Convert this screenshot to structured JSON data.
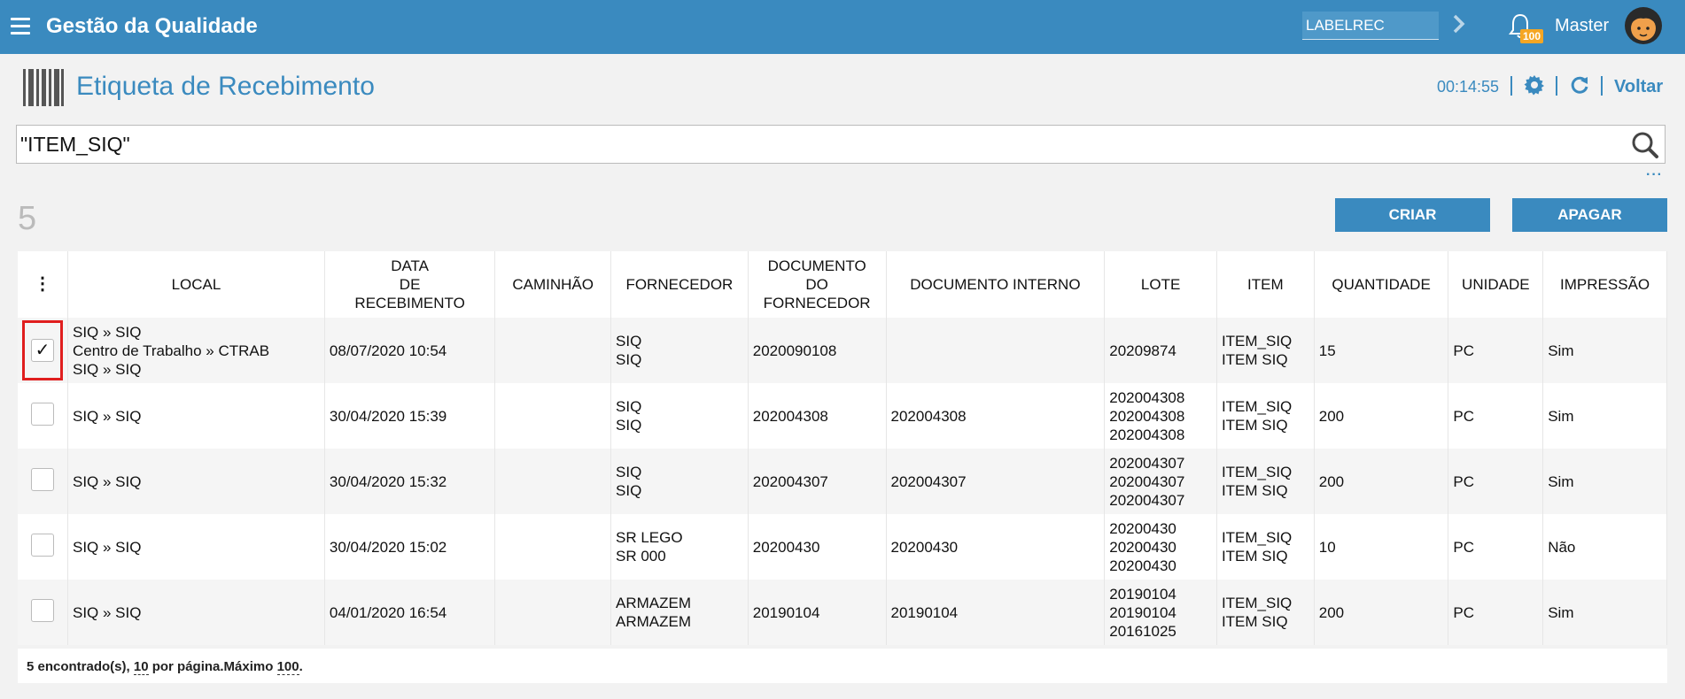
{
  "header": {
    "app_title": "Gestão da Qualidade",
    "screen_code": "LABELREC",
    "notifications": "100",
    "user": "Master"
  },
  "page": {
    "title": "Etiqueta de Recebimento",
    "clock": "00:14:55",
    "back": "Voltar"
  },
  "search": {
    "value": "\"ITEM_SIQ\""
  },
  "toolbar": {
    "count": "5",
    "create": "CRIAR",
    "delete": "APAGAR"
  },
  "table": {
    "columns": {
      "local": "LOCAL",
      "data1": "DATA",
      "data2": "DE",
      "data3": "RECEBIMENTO",
      "caminhao": "CAMINHÃO",
      "fornecedor": "FORNECEDOR",
      "doc1": "DOCUMENTO",
      "doc2": "DO",
      "doc3": "FORNECEDOR",
      "doc_interno": "DOCUMENTO INTERNO",
      "lote": "LOTE",
      "item": "ITEM",
      "quantidade": "QUANTIDADE",
      "unidade": "UNIDADE",
      "impressao": "IMPRESSÃO"
    },
    "rows": [
      {
        "checked": "✓",
        "local": [
          "SIQ » SIQ",
          "Centro de Trabalho » CTRAB",
          "SIQ » SIQ"
        ],
        "data": "08/07/2020 10:54",
        "caminhao": "",
        "fornecedor": [
          "SIQ",
          "SIQ"
        ],
        "doc_fornecedor": "2020090108",
        "doc_interno": "",
        "lote": [
          "20209874"
        ],
        "item": [
          "ITEM_SIQ",
          "ITEM SIQ"
        ],
        "quantidade": "15",
        "unidade": "PC",
        "impressao": "Sim"
      },
      {
        "checked": "",
        "local": [
          "SIQ » SIQ"
        ],
        "data": "30/04/2020 15:39",
        "caminhao": "",
        "fornecedor": [
          "SIQ",
          "SIQ"
        ],
        "doc_fornecedor": "202004308",
        "doc_interno": "202004308",
        "lote": [
          "202004308",
          "202004308",
          "202004308"
        ],
        "item": [
          "ITEM_SIQ",
          "ITEM SIQ"
        ],
        "quantidade": "200",
        "unidade": "PC",
        "impressao": "Sim"
      },
      {
        "checked": "",
        "local": [
          "SIQ » SIQ"
        ],
        "data": "30/04/2020 15:32",
        "caminhao": "",
        "fornecedor": [
          "SIQ",
          "SIQ"
        ],
        "doc_fornecedor": "202004307",
        "doc_interno": "202004307",
        "lote": [
          "202004307",
          "202004307",
          "202004307"
        ],
        "item": [
          "ITEM_SIQ",
          "ITEM SIQ"
        ],
        "quantidade": "200",
        "unidade": "PC",
        "impressao": "Sim"
      },
      {
        "checked": "",
        "local": [
          "SIQ » SIQ"
        ],
        "data": "30/04/2020 15:02",
        "caminhao": "",
        "fornecedor": [
          "SR LEGO",
          "SR 000"
        ],
        "doc_fornecedor": "20200430",
        "doc_interno": "20200430",
        "lote": [
          "20200430",
          "20200430",
          "20200430"
        ],
        "item": [
          "ITEM_SIQ",
          "ITEM SIQ"
        ],
        "quantidade": "10",
        "unidade": "PC",
        "impressao": "Não"
      },
      {
        "checked": "",
        "local": [
          "SIQ » SIQ"
        ],
        "data": "04/01/2020 16:54",
        "caminhao": "",
        "fornecedor": [
          "ARMAZEM",
          "ARMAZEM"
        ],
        "doc_fornecedor": "20190104",
        "doc_interno": "20190104",
        "lote": [
          "20190104",
          "20190104",
          "20161025"
        ],
        "item": [
          "ITEM_SIQ",
          "ITEM SIQ"
        ],
        "quantidade": "200",
        "unidade": "PC",
        "impressao": "Sim"
      }
    ]
  },
  "footer": {
    "found": "5 encontrado(s),",
    "per_page": "10",
    "per_page_label": "por página.Máximo",
    "max": "100",
    "end": "."
  },
  "icons": {
    "menu": "hamburger-icon",
    "go": "chevron-right-icon",
    "bell": "bell-icon",
    "page": "barcode-icon",
    "settings": "gear-icon",
    "refresh": "refresh-icon",
    "search": "search-icon"
  },
  "colors": {
    "primary": "#3a8abf",
    "badge": "#f5a623",
    "highlight": "#e01e1e"
  }
}
